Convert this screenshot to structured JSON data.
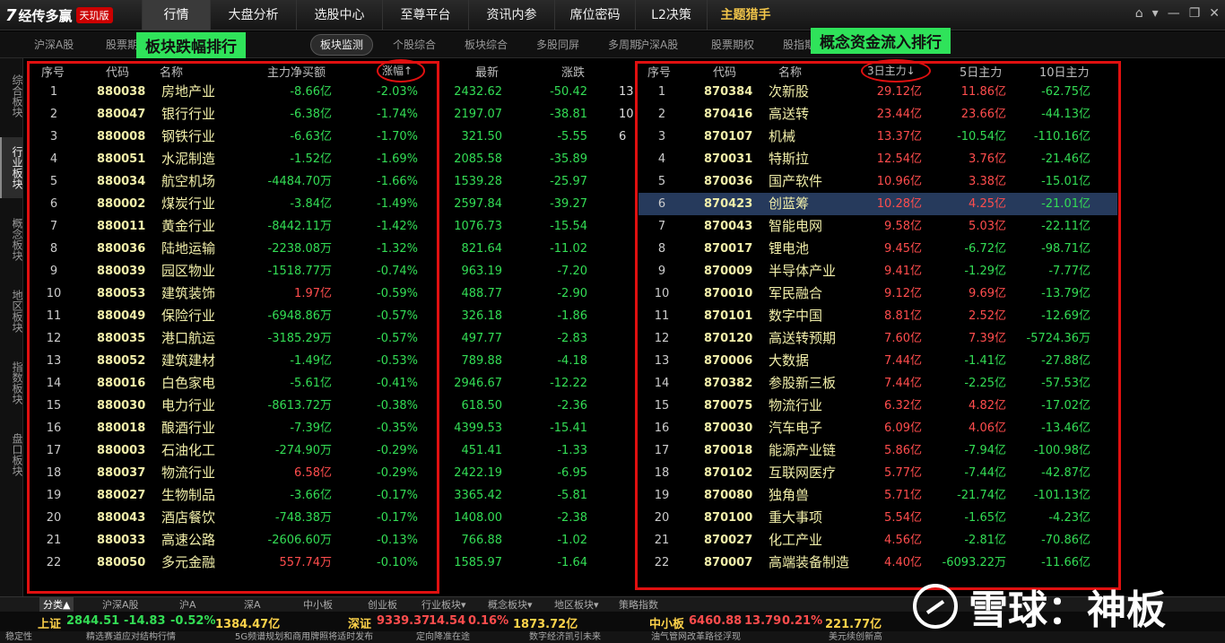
{
  "app": {
    "logo_mark": "7",
    "name": "经传多赢",
    "edition": "天玑版"
  },
  "mainnav": [
    {
      "label": "行情",
      "w": 76,
      "active": true
    },
    {
      "label": "大盘分析",
      "w": 96
    },
    {
      "label": "选股中心",
      "w": 96
    },
    {
      "label": "至尊平台",
      "w": 96
    },
    {
      "label": "资讯内参",
      "w": 96
    },
    {
      "label": "席位密码",
      "w": 90
    },
    {
      "label": "L2决策",
      "w": 80
    },
    {
      "label": "主题猎手",
      "w": 86,
      "bold": true
    }
  ],
  "window_controls": [
    "⌂",
    "▾",
    "—",
    "❐",
    "✕"
  ],
  "subtabs_left": [
    "沪深A股",
    "股票期权"
  ],
  "subtab_active": "板块监测",
  "subtabs_mid": [
    "个股综合",
    "板块综合",
    "多股同屏",
    "多周期"
  ],
  "subtabs_right": [
    "沪深A股",
    "股票期权",
    "股指期货"
  ],
  "vnav": [
    "综合板块",
    "行业板块",
    "概念板块",
    "地区板块",
    "指数板块",
    "盘口板块"
  ],
  "annotations": {
    "left_label": "板块跌幅排行",
    "right_label": "概念资金流入排行"
  },
  "left_headers": {
    "idx": "序号",
    "code": "代码",
    "name": "名称",
    "net": "主力净买额",
    "pct": "涨幅↑",
    "last": "最新",
    "chg": "涨跌"
  },
  "left_rows": [
    {
      "i": "1",
      "code": "880038",
      "name": "房地产业",
      "net": "-8.66亿",
      "pct": "-2.03%",
      "last": "2432.62",
      "chg": "-50.42",
      "ext": "13"
    },
    {
      "i": "2",
      "code": "880047",
      "name": "银行行业",
      "net": "-6.38亿",
      "pct": "-1.74%",
      "last": "2197.07",
      "chg": "-38.81",
      "ext": "10"
    },
    {
      "i": "3",
      "code": "880008",
      "name": "钢铁行业",
      "net": "-6.63亿",
      "pct": "-1.70%",
      "last": "321.50",
      "chg": "-5.55",
      "ext": "6"
    },
    {
      "i": "4",
      "code": "880051",
      "name": "水泥制造",
      "net": "-1.52亿",
      "pct": "-1.69%",
      "last": "2085.58",
      "chg": "-35.89",
      "ext": ""
    },
    {
      "i": "5",
      "code": "880034",
      "name": "航空机场",
      "net": "-4484.70万",
      "pct": "-1.66%",
      "last": "1539.28",
      "chg": "-25.97",
      "ext": ""
    },
    {
      "i": "6",
      "code": "880002",
      "name": "煤炭行业",
      "net": "-3.84亿",
      "pct": "-1.49%",
      "last": "2597.84",
      "chg": "-39.27",
      "ext": ""
    },
    {
      "i": "7",
      "code": "880011",
      "name": "黄金行业",
      "net": "-8442.11万",
      "pct": "-1.42%",
      "last": "1076.73",
      "chg": "-15.54",
      "ext": ""
    },
    {
      "i": "8",
      "code": "880036",
      "name": "陆地运输",
      "net": "-2238.08万",
      "pct": "-1.32%",
      "last": "821.64",
      "chg": "-11.02",
      "ext": ""
    },
    {
      "i": "9",
      "code": "880039",
      "name": "园区物业",
      "net": "-1518.77万",
      "pct": "-0.74%",
      "last": "963.19",
      "chg": "-7.20",
      "ext": ""
    },
    {
      "i": "10",
      "code": "880053",
      "name": "建筑装饰",
      "net": "1.97亿",
      "pct": "-0.59%",
      "last": "488.77",
      "chg": "-2.90",
      "ext": ""
    },
    {
      "i": "11",
      "code": "880049",
      "name": "保险行业",
      "net": "-6948.86万",
      "pct": "-0.57%",
      "last": "326.18",
      "chg": "-1.86",
      "ext": ""
    },
    {
      "i": "12",
      "code": "880035",
      "name": "港口航运",
      "net": "-3185.29万",
      "pct": "-0.57%",
      "last": "497.77",
      "chg": "-2.83",
      "ext": ""
    },
    {
      "i": "13",
      "code": "880052",
      "name": "建筑建材",
      "net": "-1.49亿",
      "pct": "-0.53%",
      "last": "789.88",
      "chg": "-4.18",
      "ext": ""
    },
    {
      "i": "14",
      "code": "880016",
      "name": "白色家电",
      "net": "-5.61亿",
      "pct": "-0.41%",
      "last": "2946.67",
      "chg": "-12.22",
      "ext": ""
    },
    {
      "i": "15",
      "code": "880030",
      "name": "电力行业",
      "net": "-8613.72万",
      "pct": "-0.38%",
      "last": "618.50",
      "chg": "-2.36",
      "ext": ""
    },
    {
      "i": "16",
      "code": "880018",
      "name": "酿酒行业",
      "net": "-7.39亿",
      "pct": "-0.35%",
      "last": "4399.53",
      "chg": "-15.41",
      "ext": ""
    },
    {
      "i": "17",
      "code": "880003",
      "name": "石油化工",
      "net": "-274.90万",
      "pct": "-0.29%",
      "last": "451.41",
      "chg": "-1.33",
      "ext": ""
    },
    {
      "i": "18",
      "code": "880037",
      "name": "物流行业",
      "net": "6.58亿",
      "pct": "-0.29%",
      "last": "2422.19",
      "chg": "-6.95",
      "ext": ""
    },
    {
      "i": "19",
      "code": "880027",
      "name": "生物制品",
      "net": "-3.66亿",
      "pct": "-0.17%",
      "last": "3365.42",
      "chg": "-5.81",
      "ext": ""
    },
    {
      "i": "20",
      "code": "880043",
      "name": "酒店餐饮",
      "net": "-748.38万",
      "pct": "-0.17%",
      "last": "1408.00",
      "chg": "-2.38",
      "ext": ""
    },
    {
      "i": "21",
      "code": "880033",
      "name": "高速公路",
      "net": "-2606.60万",
      "pct": "-0.13%",
      "last": "766.88",
      "chg": "-1.02",
      "ext": ""
    },
    {
      "i": "22",
      "code": "880050",
      "name": "多元金融",
      "net": "557.74万",
      "pct": "-0.10%",
      "last": "1585.97",
      "chg": "-1.64",
      "ext": ""
    }
  ],
  "right_headers": {
    "idx": "序号",
    "code": "代码",
    "name": "名称",
    "d3": "3日主力↓",
    "d5": "5日主力",
    "d10": "10日主力"
  },
  "right_rows": [
    {
      "i": "1",
      "code": "870384",
      "name": "次新股",
      "d3": "29.12亿",
      "d5": "11.86亿",
      "d10": "-62.75亿"
    },
    {
      "i": "2",
      "code": "870416",
      "name": "高送转",
      "d3": "23.44亿",
      "d5": "23.66亿",
      "d10": "-44.13亿"
    },
    {
      "i": "3",
      "code": "870107",
      "name": "机械",
      "d3": "13.37亿",
      "d5": "-10.54亿",
      "d10": "-110.16亿"
    },
    {
      "i": "4",
      "code": "870031",
      "name": "特斯拉",
      "d3": "12.54亿",
      "d5": "3.76亿",
      "d10": "-21.46亿"
    },
    {
      "i": "5",
      "code": "870036",
      "name": "国产软件",
      "d3": "10.96亿",
      "d5": "3.38亿",
      "d10": "-15.01亿"
    },
    {
      "i": "6",
      "code": "870423",
      "name": "创蓝筹",
      "d3": "10.28亿",
      "d5": "4.25亿",
      "d10": "-21.01亿",
      "sel": true
    },
    {
      "i": "7",
      "code": "870043",
      "name": "智能电网",
      "d3": "9.58亿",
      "d5": "5.03亿",
      "d10": "-22.11亿"
    },
    {
      "i": "8",
      "code": "870017",
      "name": "锂电池",
      "d3": "9.45亿",
      "d5": "-6.72亿",
      "d10": "-98.71亿"
    },
    {
      "i": "9",
      "code": "870009",
      "name": "半导体产业",
      "d3": "9.41亿",
      "d5": "-1.29亿",
      "d10": "-7.77亿"
    },
    {
      "i": "10",
      "code": "870010",
      "name": "军民融合",
      "d3": "9.12亿",
      "d5": "9.69亿",
      "d10": "-13.79亿"
    },
    {
      "i": "11",
      "code": "870101",
      "name": "数字中国",
      "d3": "8.81亿",
      "d5": "2.52亿",
      "d10": "-12.69亿"
    },
    {
      "i": "12",
      "code": "870120",
      "name": "高送转预期",
      "d3": "7.60亿",
      "d5": "7.39亿",
      "d10": "-5724.36万"
    },
    {
      "i": "13",
      "code": "870006",
      "name": "大数据",
      "d3": "7.44亿",
      "d5": "-1.41亿",
      "d10": "-27.88亿"
    },
    {
      "i": "14",
      "code": "870382",
      "name": "参股新三板",
      "d3": "7.44亿",
      "d5": "-2.25亿",
      "d10": "-57.53亿"
    },
    {
      "i": "15",
      "code": "870075",
      "name": "物流行业",
      "d3": "6.32亿",
      "d5": "4.82亿",
      "d10": "-17.02亿"
    },
    {
      "i": "16",
      "code": "870030",
      "name": "汽车电子",
      "d3": "6.09亿",
      "d5": "4.06亿",
      "d10": "-13.46亿"
    },
    {
      "i": "17",
      "code": "870018",
      "name": "能源产业链",
      "d3": "5.86亿",
      "d5": "-7.94亿",
      "d10": "-100.98亿"
    },
    {
      "i": "18",
      "code": "870102",
      "name": "互联网医疗",
      "d3": "5.77亿",
      "d5": "-7.44亿",
      "d10": "-42.87亿"
    },
    {
      "i": "19",
      "code": "870080",
      "name": "独角兽",
      "d3": "5.71亿",
      "d5": "-21.74亿",
      "d10": "-101.13亿"
    },
    {
      "i": "20",
      "code": "870100",
      "name": "重大事项",
      "d3": "5.54亿",
      "d5": "-1.65亿",
      "d10": "-4.23亿"
    },
    {
      "i": "21",
      "code": "870027",
      "name": "化工产业",
      "d3": "4.56亿",
      "d5": "-2.81亿",
      "d10": "-70.86亿"
    },
    {
      "i": "22",
      "code": "870007",
      "name": "高端装备制造",
      "d3": "4.40亿",
      "d5": "-6093.22万",
      "d10": "-11.66亿"
    }
  ],
  "bottom_tabs": [
    "分类▲",
    "沪深A股",
    "沪A",
    "深A",
    "中小板",
    "创业板",
    "行业板块▾",
    "概念板块▾",
    "地区板块▾",
    "策略指数"
  ],
  "ticker": {
    "sh": {
      "name": "上证",
      "v": "2844.51",
      "chg": "-14.83",
      "pct": "-0.52%",
      "amt": "1384.47亿"
    },
    "sz": {
      "name": "深证",
      "v": "9339.37",
      "chg": "14.54",
      "pct": "0.16%",
      "amt": "1873.72亿"
    },
    "zxb": {
      "name": "中小板",
      "v": "6460.88",
      "chg": "13.79",
      "pct": "0.21%",
      "amt": "221.77亿"
    }
  },
  "news": [
    "稳定性",
    "精选赛道应对结构行情",
    "5G频谱规划和商用牌照将适时发布",
    "定向降准在途",
    "数字经济凯引未来",
    "油气管网改革路径浮现",
    "美元续创新高"
  ],
  "watermark": "雪球：神板",
  "colors": {
    "up": "#ff4d4d",
    "down": "#33dd55",
    "code": "#f2efaa",
    "annotation": "#e01010",
    "label_bg": "#2fe35a"
  }
}
